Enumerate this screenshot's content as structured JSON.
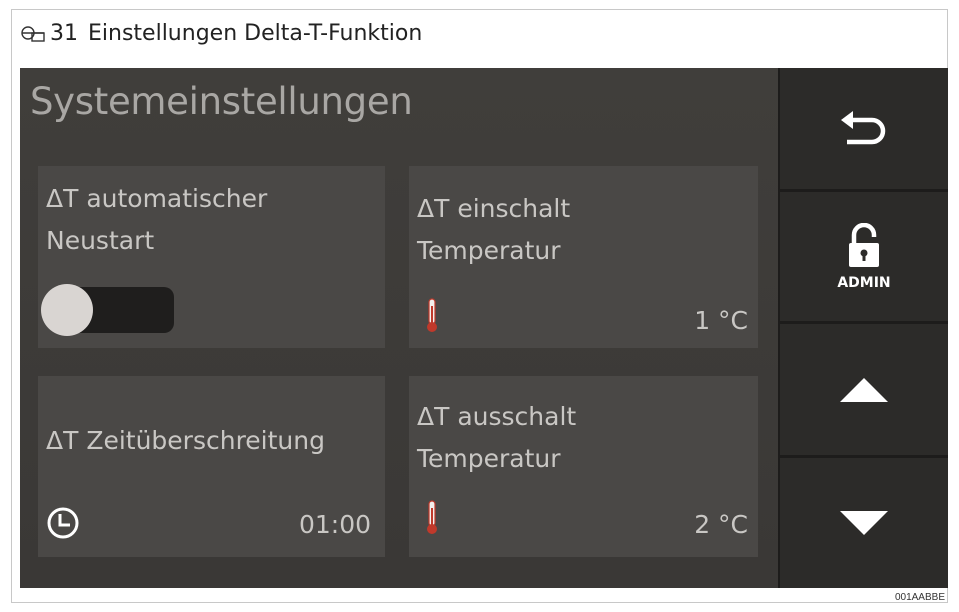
{
  "figure": {
    "number": "31",
    "title": "Einstellungen Delta-T-Funktion",
    "code": "001AABBE"
  },
  "screen": {
    "title": "Systemeinstellungen"
  },
  "tiles": [
    {
      "label_line1": "ΔT automatischer",
      "label_line2": "Neustart",
      "toggle_state": "off"
    },
    {
      "label_line1": "ΔT einschalt",
      "label_line2": "Temperatur",
      "value": "1 °C",
      "icon": "thermometer-icon"
    },
    {
      "label_line1": "ΔT Zeitüberschreitung",
      "value": "01:00",
      "icon": "clock-icon"
    },
    {
      "label_line1": "ΔT ausschalt",
      "label_line2": "Temperatur",
      "value": "2 °C",
      "icon": "thermometer-icon"
    }
  ],
  "sidebar": {
    "back_icon": "back-arrow-icon",
    "lock_icon": "padlock-icon",
    "admin_label": "ADMIN",
    "up_icon": "triangle-up-icon",
    "down_icon": "triangle-down-icon"
  },
  "colors": {
    "screen_bg": "#3b3937",
    "tile_bg": "#4a4846",
    "sidebar_btn": "#2c2b29",
    "thermometer_red": "#c0392b",
    "toggle_knob": "#d9d5d2"
  }
}
